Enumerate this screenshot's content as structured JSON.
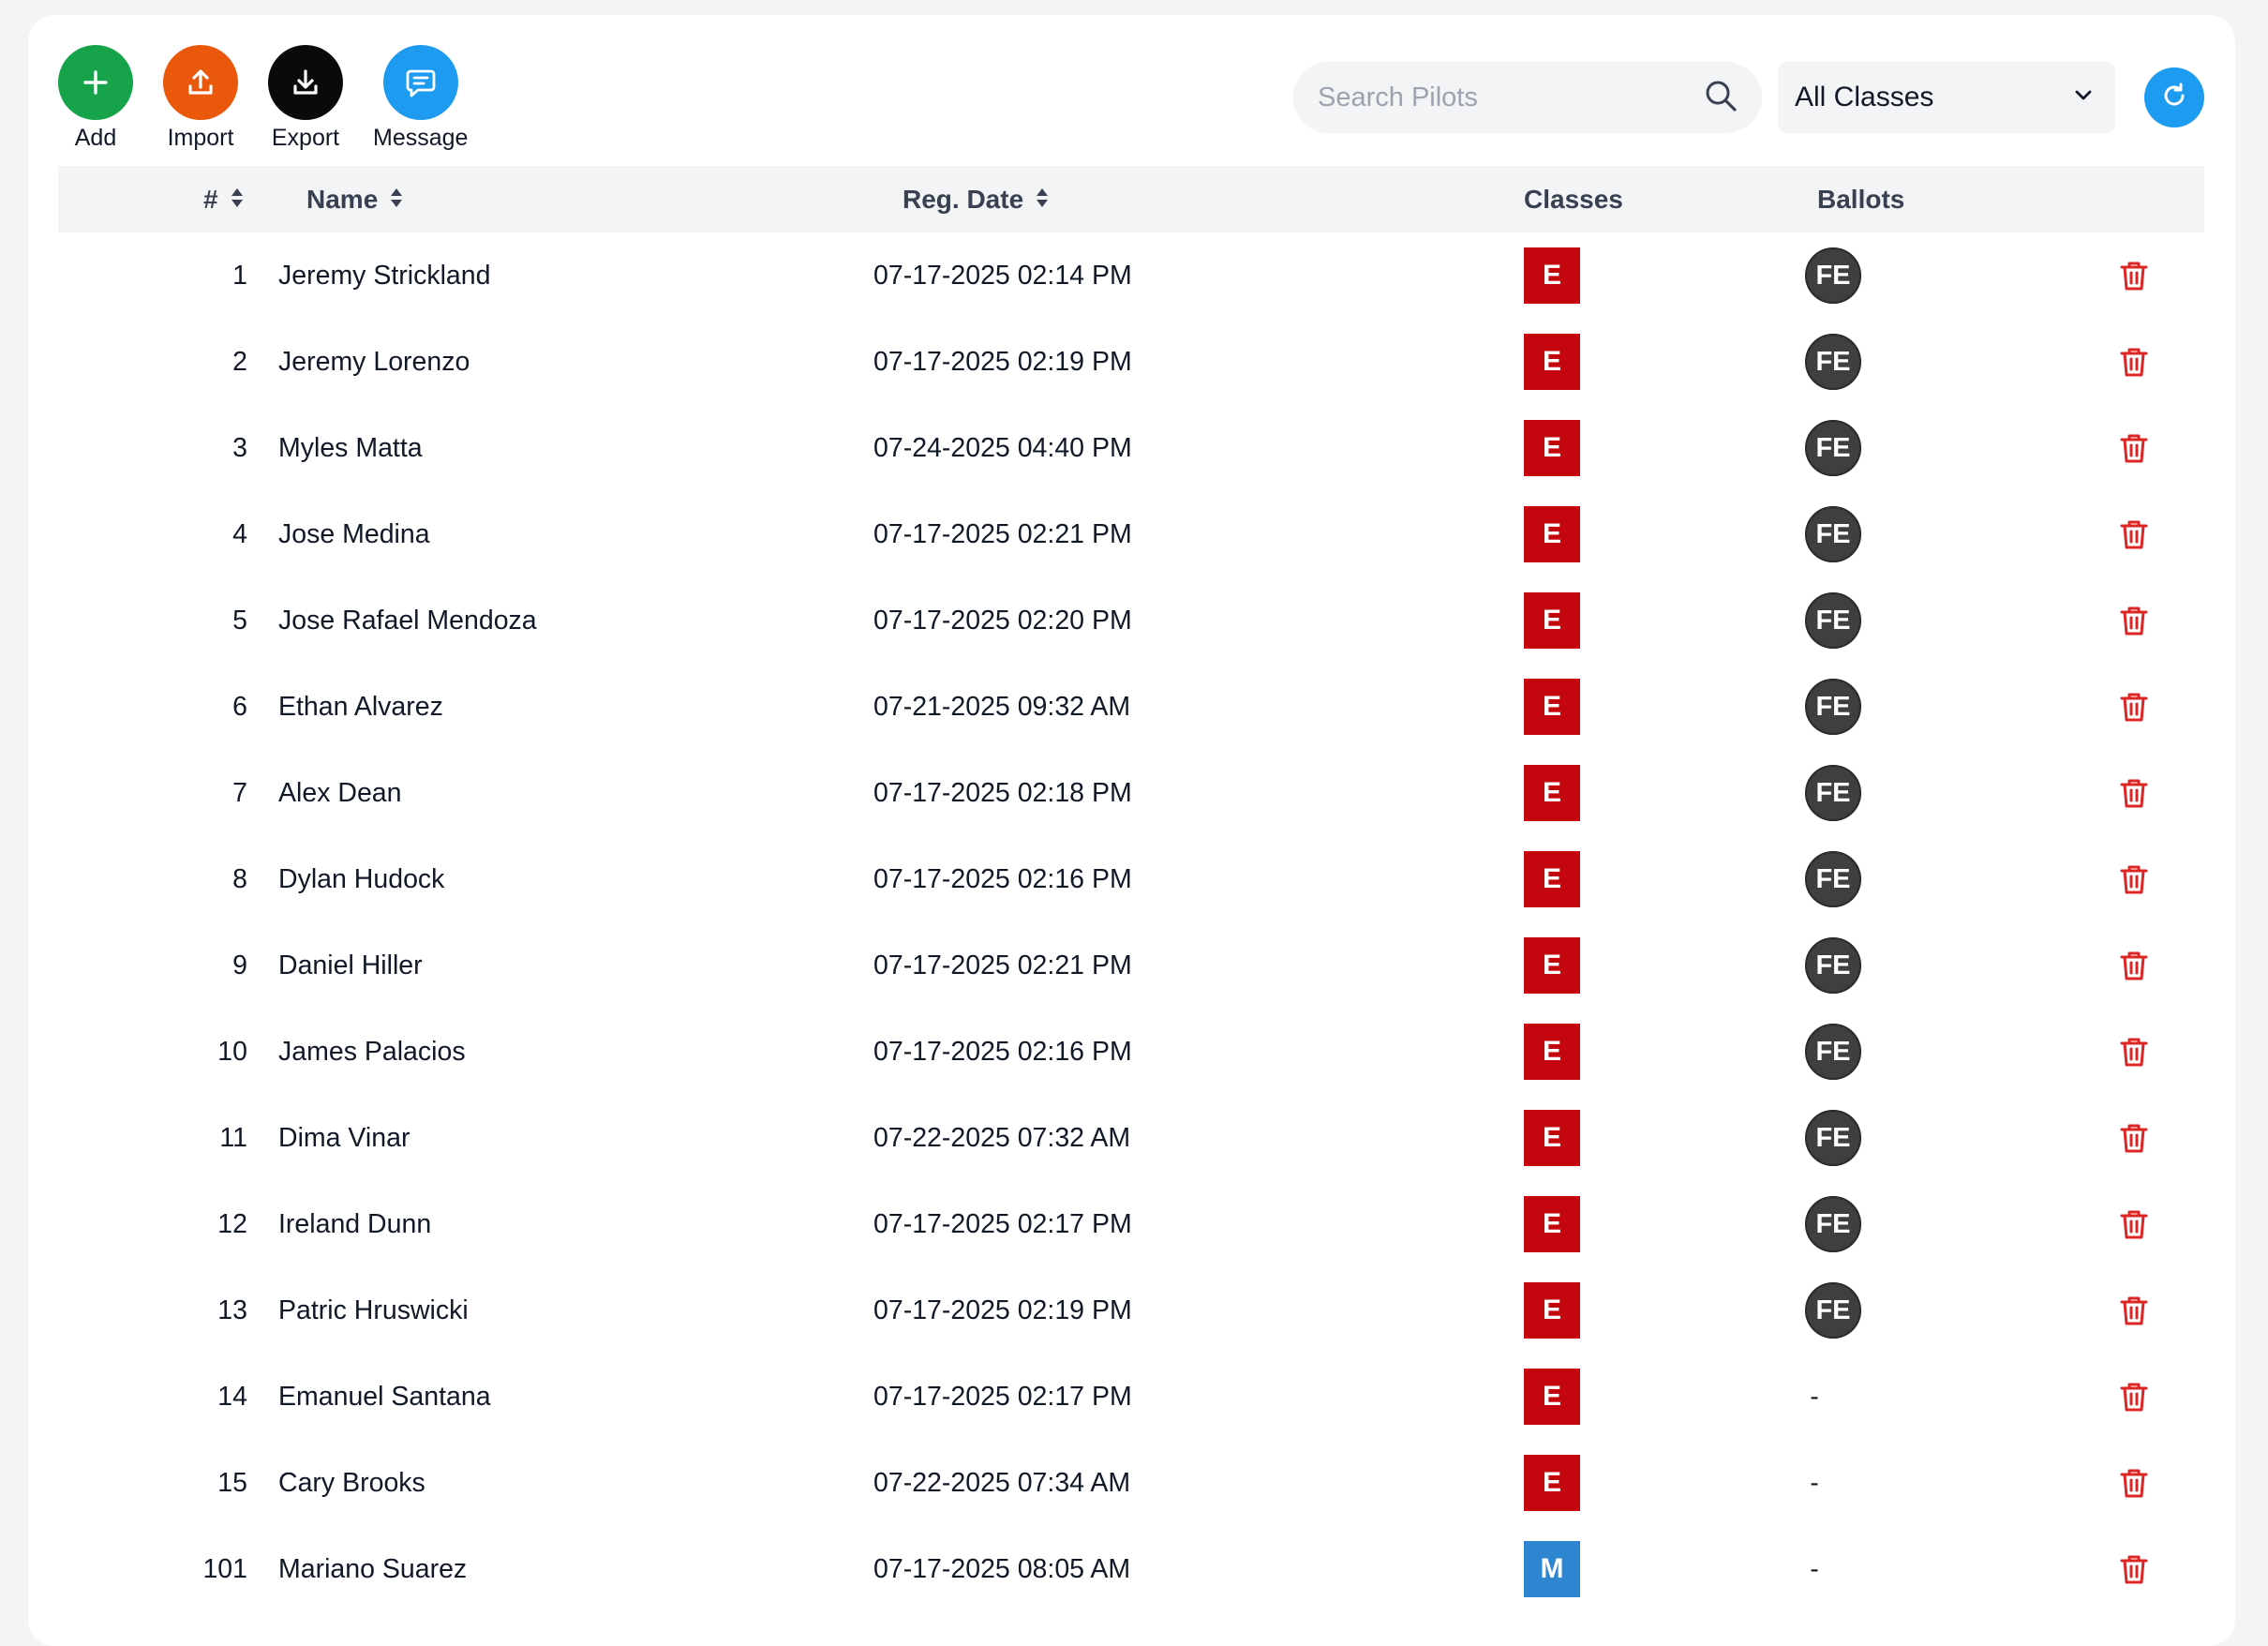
{
  "colors": {
    "add": "#16a34a",
    "import": "#ea580c",
    "export": "#0a0a0a",
    "message": "#1d9bf0",
    "refresh": "#1d9bf0",
    "class_E": "#c4060f",
    "class_M": "#2f86d0",
    "ballot": "#3f3f3f",
    "delete": "#dc2626"
  },
  "toolbar": {
    "actions": [
      {
        "label": "Add",
        "icon": "plus-icon"
      },
      {
        "label": "Import",
        "icon": "upload-icon"
      },
      {
        "label": "Export",
        "icon": "download-icon"
      },
      {
        "label": "Message",
        "icon": "message-icon"
      }
    ],
    "search_placeholder": "Search Pilots",
    "class_filter": "All Classes",
    "refresh_icon": "refresh-icon"
  },
  "table": {
    "headers": {
      "num": "#",
      "name": "Name",
      "reg_date": "Reg. Date",
      "classes": "Classes",
      "ballots": "Ballots"
    },
    "rows": [
      {
        "num": "1",
        "name": "Jeremy Strickland",
        "date": "07-17-2025 02:14 PM",
        "cls": "E",
        "ballot": "FE"
      },
      {
        "num": "2",
        "name": "Jeremy Lorenzo",
        "date": "07-17-2025 02:19 PM",
        "cls": "E",
        "ballot": "FE"
      },
      {
        "num": "3",
        "name": "Myles Matta",
        "date": "07-24-2025 04:40 PM",
        "cls": "E",
        "ballot": "FE"
      },
      {
        "num": "4",
        "name": "Jose Medina",
        "date": "07-17-2025 02:21 PM",
        "cls": "E",
        "ballot": "FE"
      },
      {
        "num": "5",
        "name": "Jose Rafael Mendoza",
        "date": "07-17-2025 02:20 PM",
        "cls": "E",
        "ballot": "FE"
      },
      {
        "num": "6",
        "name": "Ethan Alvarez",
        "date": "07-21-2025 09:32 AM",
        "cls": "E",
        "ballot": "FE"
      },
      {
        "num": "7",
        "name": "Alex Dean",
        "date": "07-17-2025 02:18 PM",
        "cls": "E",
        "ballot": "FE"
      },
      {
        "num": "8",
        "name": "Dylan Hudock",
        "date": "07-17-2025 02:16 PM",
        "cls": "E",
        "ballot": "FE"
      },
      {
        "num": "9",
        "name": "Daniel Hiller",
        "date": "07-17-2025 02:21 PM",
        "cls": "E",
        "ballot": "FE"
      },
      {
        "num": "10",
        "name": "James Palacios",
        "date": "07-17-2025 02:16 PM",
        "cls": "E",
        "ballot": "FE"
      },
      {
        "num": "11",
        "name": "Dima Vinar",
        "date": "07-22-2025 07:32 AM",
        "cls": "E",
        "ballot": "FE"
      },
      {
        "num": "12",
        "name": "Ireland Dunn",
        "date": "07-17-2025 02:17 PM",
        "cls": "E",
        "ballot": "FE"
      },
      {
        "num": "13",
        "name": "Patric Hruswicki",
        "date": "07-17-2025 02:19 PM",
        "cls": "E",
        "ballot": "FE"
      },
      {
        "num": "14",
        "name": "Emanuel Santana",
        "date": "07-17-2025 02:17 PM",
        "cls": "E",
        "ballot": "-"
      },
      {
        "num": "15",
        "name": "Cary Brooks",
        "date": "07-22-2025 07:34 AM",
        "cls": "E",
        "ballot": "-"
      },
      {
        "num": "101",
        "name": "Mariano Suarez",
        "date": "07-17-2025 08:05 AM",
        "cls": "M",
        "ballot": "-"
      }
    ]
  }
}
